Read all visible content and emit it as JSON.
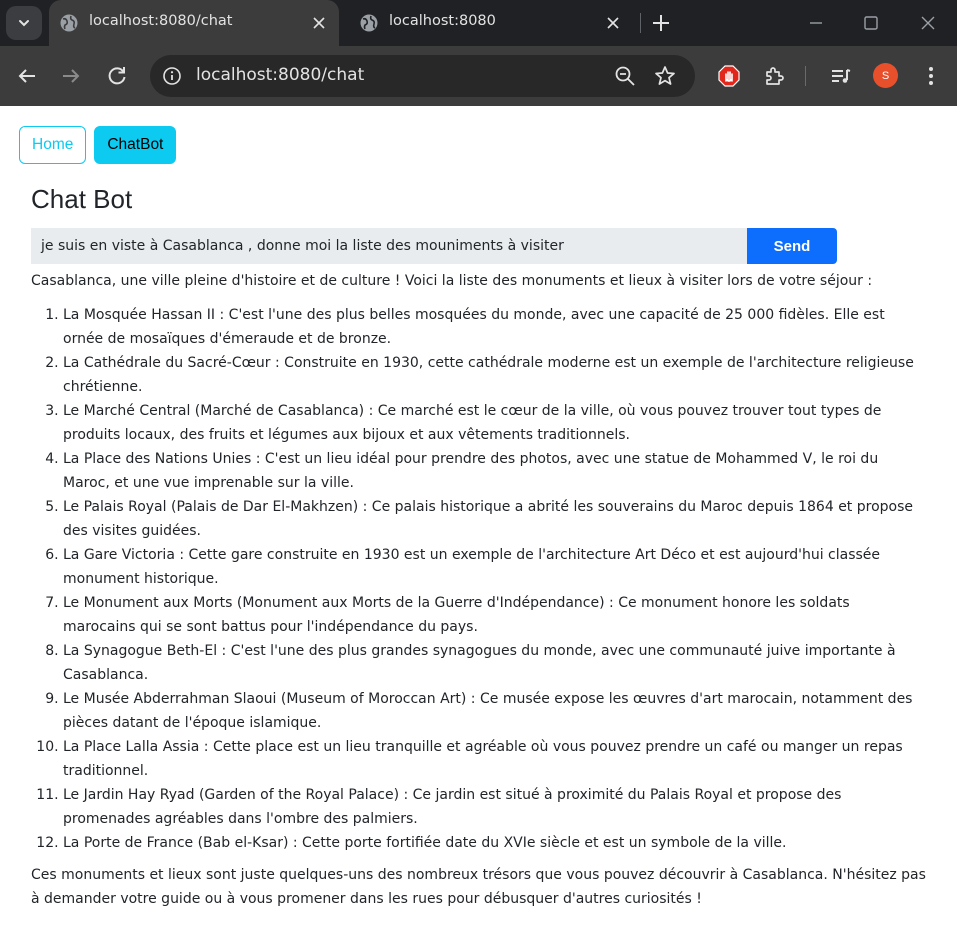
{
  "browser": {
    "tabs": [
      {
        "title": "localhost:8080/chat",
        "active": true
      },
      {
        "title": "localhost:8080",
        "active": false
      }
    ],
    "address": "localhost:8080/chat",
    "profile_initial": "S",
    "accent_colors": {
      "tabstrip": "#202124",
      "toolbar": "#3c3c3c",
      "avatar": "#e8502c"
    }
  },
  "nav": {
    "home_label": "Home",
    "chatbot_label": "ChatBot"
  },
  "page_title": "Chat Bot",
  "chat": {
    "input_value": "je suis en viste à Casablanca , donne moi la liste des mouniments à visiter",
    "send_label": "Send"
  },
  "answer": {
    "intro": "Casablanca, une ville pleine d'histoire et de culture ! Voici la liste des monuments et lieux à visiter lors de votre séjour :",
    "items": [
      "La Mosquée Hassan II : C'est l'une des plus belles mosquées du monde, avec une capacité de 25 000 fidèles. Elle est ornée de mosaïques d'émeraude et de bronze.",
      "La Cathédrale du Sacré-Cœur : Construite en 1930, cette cathédrale moderne est un exemple de l'architecture religieuse chrétienne.",
      "Le Marché Central (Marché de Casablanca) : Ce marché est le cœur de la ville, où vous pouvez trouver tout types de produits locaux, des fruits et légumes aux bijoux et aux vêtements traditionnels.",
      "La Place des Nations Unies : C'est un lieu idéal pour prendre des photos, avec une statue de Mohammed V, le roi du Maroc, et une vue imprenable sur la ville.",
      "Le Palais Royal (Palais de Dar El-Makhzen) : Ce palais historique a abrité les souverains du Maroc depuis 1864 et propose des visites guidées.",
      "La Gare Victoria : Cette gare construite en 1930 est un exemple de l'architecture Art Déco et est aujourd'hui classée monument historique.",
      "Le Monument aux Morts (Monument aux Morts de la Guerre d'Indépendance) : Ce monument honore les soldats marocains qui se sont battus pour l'indépendance du pays.",
      "La Synagogue Beth-El : C'est l'une des plus grandes synagogues du monde, avec une communauté juive importante à Casablanca.",
      "Le Musée Abderrahman Slaoui (Museum of Moroccan Art) : Ce musée expose les œuvres d'art marocain, notamment des pièces datant de l'époque islamique.",
      "La Place Lalla Assia : Cette place est un lieu tranquille et agréable où vous pouvez prendre un café ou manger un repas traditionnel.",
      "Le Jardin Hay Ryad (Garden of the Royal Palace) : Ce jardin est situé à proximité du Palais Royal et propose des promenades agréables dans l'ombre des palmiers.",
      "La Porte de France (Bab el-Ksar) : Cette porte fortifiée date du XVIe siècle et est un symbole de la ville."
    ],
    "outro": "Ces monuments et lieux sont juste quelques-uns des nombreux trésors que vous pouvez découvrir à Casablanca. N'hésitez pas à demander votre guide ou à vous promener dans les rues pour débusquer d'autres curiosités !"
  }
}
